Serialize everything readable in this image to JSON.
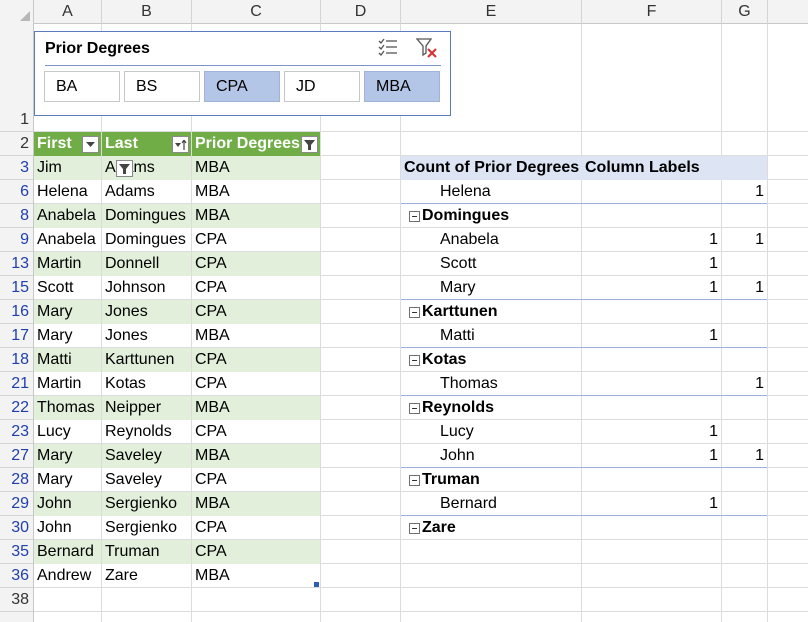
{
  "columns": [
    "A",
    "B",
    "C",
    "D",
    "E",
    "F",
    "G"
  ],
  "row_numbers": [
    "1",
    "2",
    "3",
    "6",
    "8",
    "9",
    "13",
    "15",
    "16",
    "17",
    "18",
    "21",
    "22",
    "23",
    "27",
    "28",
    "29",
    "30",
    "35",
    "36",
    "38"
  ],
  "slicer": {
    "title": "Prior Degrees",
    "items": [
      {
        "label": "BA",
        "selected": false
      },
      {
        "label": "BS",
        "selected": false
      },
      {
        "label": "CPA",
        "selected": true
      },
      {
        "label": "JD",
        "selected": false
      },
      {
        "label": "MBA",
        "selected": true
      }
    ]
  },
  "table": {
    "headers": [
      "First",
      "Last",
      "Prior Degrees"
    ],
    "rows": [
      [
        "Jim",
        "Adams",
        "MBA"
      ],
      [
        "Helena",
        "Adams",
        "MBA"
      ],
      [
        "Anabela",
        "Domingues",
        "MBA"
      ],
      [
        "Anabela",
        "Domingues",
        "CPA"
      ],
      [
        "Martin",
        "Donnell",
        "CPA"
      ],
      [
        "Scott",
        "Johnson",
        "CPA"
      ],
      [
        "Mary",
        "Jones",
        "CPA"
      ],
      [
        "Mary",
        "Jones",
        "MBA"
      ],
      [
        "Matti",
        "Karttunen",
        "CPA"
      ],
      [
        "Martin",
        "Kotas",
        "CPA"
      ],
      [
        "Thomas",
        "Neipper",
        "MBA"
      ],
      [
        "Lucy",
        "Reynolds",
        "CPA"
      ],
      [
        "Mary",
        "Saveley",
        "MBA"
      ],
      [
        "Mary",
        "Saveley",
        "CPA"
      ],
      [
        "John",
        "Sergienko",
        "MBA"
      ],
      [
        "John",
        "Sergienko",
        "CPA"
      ],
      [
        "Bernard",
        "Truman",
        "CPA"
      ],
      [
        "Andrew",
        "Zare",
        "MBA"
      ]
    ]
  },
  "pivot": {
    "value_label": "Count of Prior Degrees",
    "column_labels": "Column Labels",
    "rows": [
      {
        "kind": "item",
        "label": "Helena",
        "f": "",
        "g": "1"
      },
      {
        "kind": "group",
        "label": "Domingues",
        "f": "",
        "g": ""
      },
      {
        "kind": "item",
        "label": "Anabela",
        "f": "1",
        "g": "1"
      },
      {
        "kind": "item",
        "label": "Scott",
        "f": "1",
        "g": ""
      },
      {
        "kind": "item",
        "label": "Mary",
        "f": "1",
        "g": "1"
      },
      {
        "kind": "group",
        "label": "Karttunen",
        "f": "",
        "g": ""
      },
      {
        "kind": "item",
        "label": "Matti",
        "f": "1",
        "g": ""
      },
      {
        "kind": "group",
        "label": "Kotas",
        "f": "",
        "g": ""
      },
      {
        "kind": "item",
        "label": "Thomas",
        "f": "",
        "g": "1"
      },
      {
        "kind": "group",
        "label": "Reynolds",
        "f": "",
        "g": ""
      },
      {
        "kind": "item",
        "label": "Lucy",
        "f": "1",
        "g": ""
      },
      {
        "kind": "item",
        "label": "John",
        "f": "1",
        "g": "1"
      },
      {
        "kind": "group",
        "label": "Truman",
        "f": "",
        "g": ""
      },
      {
        "kind": "item",
        "label": "Bernard",
        "f": "1",
        "g": ""
      },
      {
        "kind": "group",
        "label": "Zare",
        "f": "",
        "g": ""
      }
    ]
  },
  "colors": {
    "table_header": "#70ad47",
    "band": "#e2efda",
    "slicer_selected": "#b4c6e7",
    "row_number": "#1f3fae"
  }
}
